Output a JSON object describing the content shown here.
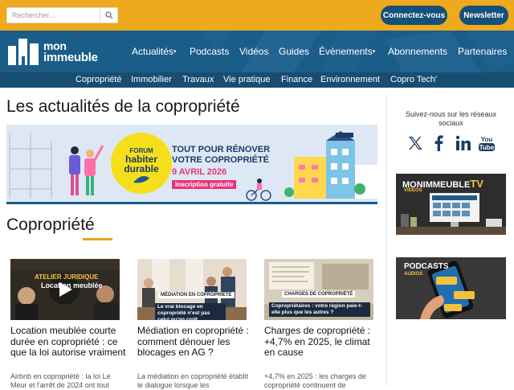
{
  "header": {
    "search_placeholder": "Rechercher...",
    "login_label": "Connectez-vous",
    "newsletter_label": "Newsletter",
    "brand_line1": "mon",
    "brand_line2": "immeuble"
  },
  "main_nav": [
    {
      "label": "Actualités",
      "has_caret": true
    },
    {
      "label": "Podcasts",
      "has_caret": false
    },
    {
      "label": "Vidéos",
      "has_caret": false
    },
    {
      "label": "Guides",
      "has_caret": false
    },
    {
      "label": "Évènements",
      "has_caret": true
    },
    {
      "label": "Abonnements",
      "has_caret": false
    },
    {
      "label": "Partenaires",
      "has_caret": false
    }
  ],
  "caret_glyph": "▾",
  "sub_nav": [
    "Copropriété",
    "Immobilier",
    "Travaux",
    "Vie pratique",
    "Finance",
    "Environnement",
    "Copro Tech'"
  ],
  "page_title": "Les actualités de la copropriété",
  "banner": {
    "forum_label": "FORUM",
    "forum_name_1": "habiter",
    "forum_name_2": "durable",
    "headline_1": "TOUT POUR RÉNOVER",
    "headline_2": "VOTRE COPROPRIÉTÉ",
    "date": "9 AVRIL 2026",
    "cta": "Inscription gratuite"
  },
  "section_title": "Copropriété",
  "cards": [
    {
      "title": "Location meublée courte durée en copropriété : ce que la loi autorise vraiment",
      "excerpt": "Airbnb en copropriété : la loi Le Meur et l'arrêt de 2024 ont tout",
      "image_caption_1": "ATELIER",
      "image_caption_2": "JURIDIQUE",
      "image_caption_3": "Location meublée"
    },
    {
      "title": "Médiation en copropriété : comment dénouer les blocages en AG ?",
      "excerpt": "La médiation en copropriété établit le dialogue lorsque les",
      "image_caption_1": "MÉDIATION EN COPROPRIÉTÉ",
      "image_caption_2": "Le vrai blocage en copropriété n'est pas celui qu'on croit"
    },
    {
      "title": "Charges de copropriété : +4,7% en 2025, le climat en cause",
      "excerpt": "+4,7% en 2025 : les charges de copropriété continuent de",
      "image_caption_1": "CHARGES DE COPROPRIÉTÉ",
      "image_caption_2": "Copropriétaires : votre région paie-t-elle plus que les autres ?"
    }
  ],
  "sidebar": {
    "follow_text": "Suivez-nous sur les réseaux sociaux",
    "social": [
      "x-icon",
      "facebook-icon",
      "linkedin-icon",
      "youtube-icon"
    ],
    "tv_title": "MONIMMEUBLE",
    "tv_suffix": "TV",
    "tv_sub": "VIDÉOS",
    "podcasts_title": "PODCASTS",
    "podcasts_sub": "AUDIOS"
  },
  "colors": {
    "topbar": "#eeaa1e",
    "nav": "#1b5d89",
    "subnav": "#184d72",
    "pill": "#15507a",
    "accent": "#e9a020"
  }
}
